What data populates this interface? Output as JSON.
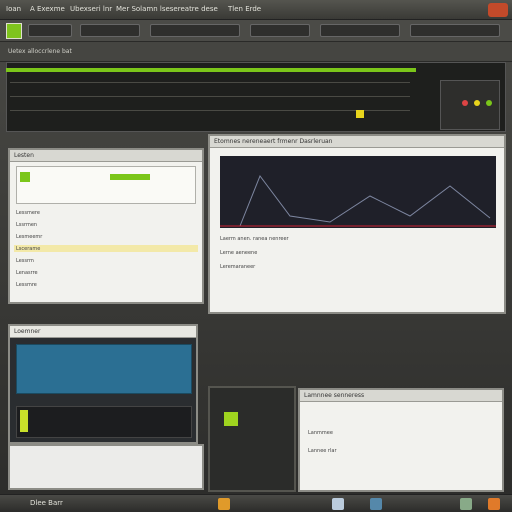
{
  "topbar": {
    "items": [
      "Ioan",
      "A Exexme",
      "Ubexseri lnr",
      "Mer Solamn lsesereatre dese",
      "Tlen Erde"
    ]
  },
  "main": {
    "title": "Uetex alloccrlene bat"
  },
  "panel1": {
    "title": "Lesten",
    "rows": [
      "Lessmere",
      "Lssrmen",
      "Lesmeemr",
      "Lscerame",
      "Lessrm",
      "Lenasrre",
      "Lessmre"
    ]
  },
  "panel2": {
    "title": "Etomnes nereneaert frmenr Dasrleruan",
    "rows": [
      "Laerm anen. ranea nenreer",
      "Lerne aeneene",
      "Leremaraneer"
    ]
  },
  "panel3": {
    "title": "Loemner"
  },
  "panel4": {
    "title": "Lamnnee senneress",
    "rows": [
      "Lanmmee",
      "Lannee rlar"
    ]
  },
  "dock": {
    "label": "Dlee Barr"
  },
  "colors": {
    "accent": "#7bc61a",
    "dark": "#1e1f1d",
    "warning": "#c34a2a"
  }
}
